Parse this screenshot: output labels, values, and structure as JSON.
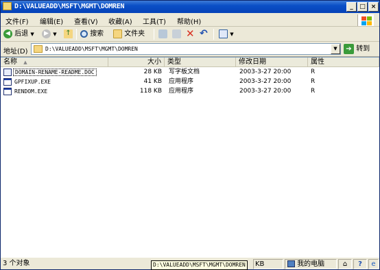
{
  "window": {
    "title": "D:\\VALUEADD\\MSFT\\MGMT\\DOMREN",
    "minimize": "_",
    "maximize": "□",
    "close": "×"
  },
  "menu": {
    "file": "文件(F)",
    "edit": "编辑(E)",
    "view": "查看(V)",
    "favorites": "收藏(A)",
    "tools": "工具(T)",
    "help": "帮助(H)"
  },
  "toolbar": {
    "back": "后退",
    "search": "搜索",
    "folders": "文件夹"
  },
  "address": {
    "label": "地址(D)",
    "value": "D:\\VALUEADD\\MSFT\\MGMT\\DOMREN",
    "go": "转到"
  },
  "columns": {
    "name": "名称",
    "size": "大小",
    "type": "类型",
    "modified": "修改日期",
    "attributes": "属性"
  },
  "files": [
    {
      "name": "DOMAIN-RENAME-README.DOC",
      "size": "28 KB",
      "type": "写字板文档",
      "modified": "2003-3-27 20:00",
      "attr": "R",
      "icon": "doc-icon"
    },
    {
      "name": "GPFIXUP.EXE",
      "size": "41 KB",
      "type": "应用程序",
      "modified": "2003-3-27 20:00",
      "attr": "R",
      "icon": "exe-icon"
    },
    {
      "name": "RENDOM.EXE",
      "size": "118 KB",
      "type": "应用程序",
      "modified": "2003-3-27 20:00",
      "attr": "R",
      "icon": "exe-icon"
    }
  ],
  "status": {
    "count": "3 个对象",
    "size": "KB",
    "location": "我的电脑"
  },
  "tooltip": "D:\\VALUEADD\\MSFT\\MGMT\\DOMREN",
  "colors": {
    "title_bar": "#0a4fc6",
    "face": "#ece9d8",
    "delete_x": "#d83020"
  }
}
